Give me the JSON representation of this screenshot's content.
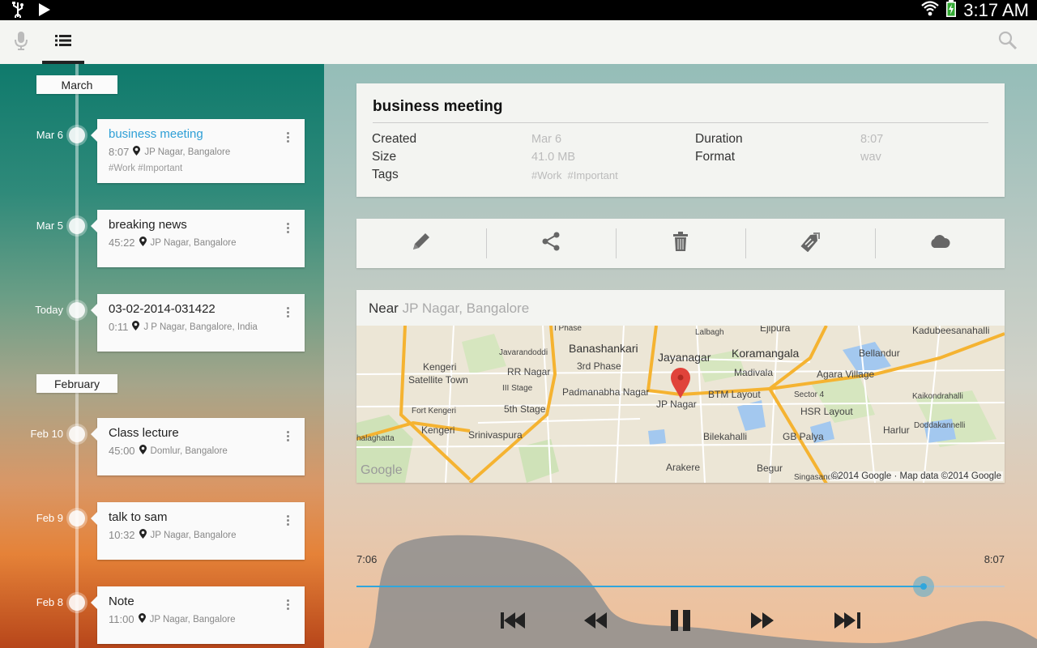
{
  "status_bar": {
    "time": "3:17 AM"
  },
  "action_bar": {
    "tabs": [
      "record",
      "list"
    ],
    "active_tab": "list"
  },
  "timeline": {
    "months": [
      "March",
      "February"
    ],
    "recordings": [
      {
        "date": "Mar 6",
        "title": "business meeting",
        "duration": "8:07",
        "location": "JP Nagar, Bangalore",
        "tags": "#Work  #Important",
        "active": true
      },
      {
        "date": "Mar 5",
        "title": "breaking news",
        "duration": "45:22",
        "location": "JP Nagar, Bangalore"
      },
      {
        "date": "Today",
        "title": "03-02-2014-031422",
        "duration": "0:11",
        "location": "J P Nagar, Bangalore, India"
      },
      {
        "date": "Feb 10",
        "title": "Class lecture",
        "duration": "45:00",
        "location": "Domlur, Bangalore"
      },
      {
        "date": "Feb 9",
        "title": "talk to sam",
        "duration": "10:32",
        "location": "JP Nagar, Bangalore"
      },
      {
        "date": "Feb 8",
        "title": "Note",
        "duration": "11:00",
        "location": "JP Nagar, Bangalore"
      }
    ]
  },
  "details": {
    "title": "business meeting",
    "labels": {
      "created": "Created",
      "size": "Size",
      "tags": "Tags",
      "duration": "Duration",
      "format": "Format"
    },
    "values": {
      "created": "Mar 6",
      "size": "41.0 MB",
      "tags": "#Work  #Important",
      "duration": "8:07",
      "format": "wav"
    }
  },
  "actions": [
    "edit-icon",
    "share-icon",
    "trash-icon",
    "tag-icon",
    "cloud-icon"
  ],
  "map": {
    "near_label": "Near",
    "place": "JP Nagar, Bangalore",
    "labels": [
      "I Phase",
      "Lalbagh",
      "Ejipura",
      "Kadubeesanahalli",
      "Javarandoddi",
      "Banashankari",
      "Jayanagar",
      "Koramangala",
      "Bellandur",
      "Kengeri",
      "Satellite Town",
      "RR Nagar",
      "3rd Phase",
      "Madivala",
      "Agara Village",
      "III Stage",
      "Padmanabha Nagar",
      "BTM Layout",
      "Sector 4",
      "Kaikondrahalli",
      "Fort Kengeri",
      "5th Stage",
      "JP Nagar",
      "HSR Layout",
      "Harlur",
      "Kengeri",
      "Srinivaspura",
      "Bilekahalli",
      "GB Palya",
      "Doddakannelli",
      "halaghatta",
      "Arakere",
      "Begur",
      "Singasandra"
    ],
    "google": "Google",
    "copyright": "©2014 Google · Map data ©2014 Google"
  },
  "player": {
    "current_time": "7:06",
    "total_time": "8:07",
    "progress": 0.8745
  },
  "colors": {
    "accent": "#2fa6dc"
  }
}
